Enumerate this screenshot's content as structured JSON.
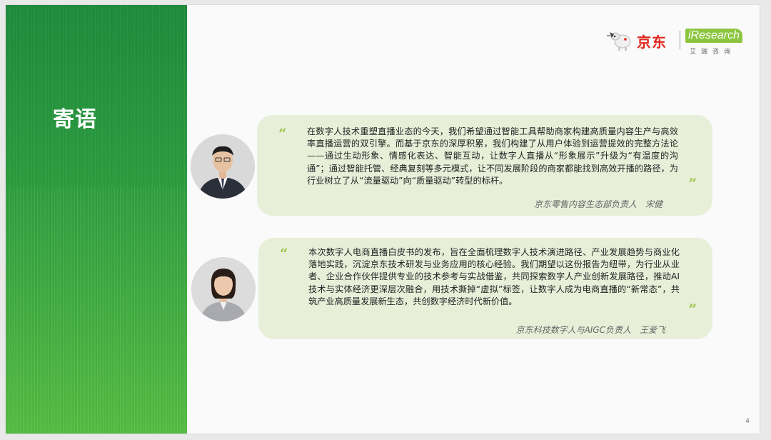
{
  "section": {
    "title": "寄语"
  },
  "logos": {
    "jd": "京东",
    "iresearch": "iResearch",
    "iresearch_cn": "艾瑞咨询"
  },
  "quotes": [
    {
      "text": "在数字人技术重塑直播业态的今天，我们希望通过智能工具帮助商家构建高质量内容生产与高效率直播运营的双引擎。而基于京东的深厚积累，我们构建了从用户体验到运营提效的完整方法论——通过生动形象、情感化表达、智能互动，让数字人直播从“形象展示”升级为“有温度的沟通”；通过智能托管、经典复刻等多元模式，让不同发展阶段的商家都能找到高效开播的路径，为行业树立了从“流量驱动”向“质量驱动”转型的标杆。",
      "signature": "京东零售内容生态部负责人　宋健"
    },
    {
      "text": "本次数字人电商直播白皮书的发布，旨在全面梳理数字人技术演进路径、产业发展趋势与商业化落地实践，沉淀京东技术研发与业务应用的核心经验。我们期望以这份报告为纽带，为行业从业者、企业合作伙伴提供专业的技术参考与实战借鉴，共同探索数字人产业创新发展路径，推动AI技术与实体经济更深层次融合，用技术撕掉“虚拟”标签，让数字人成为电商直播的“新常态”，共筑产业高质量发展新生态，共创数字经济时代新价值。",
      "signature": "京东科技数字人与AIGC负责人　王爱飞"
    }
  ],
  "page_number": "4",
  "colors": {
    "green_dark": "#1f8a3c",
    "green_light": "#52b83f",
    "card_bg": "#e8efd9",
    "quote_mark": "#9dc24a",
    "jd_red": "#e1251b"
  }
}
